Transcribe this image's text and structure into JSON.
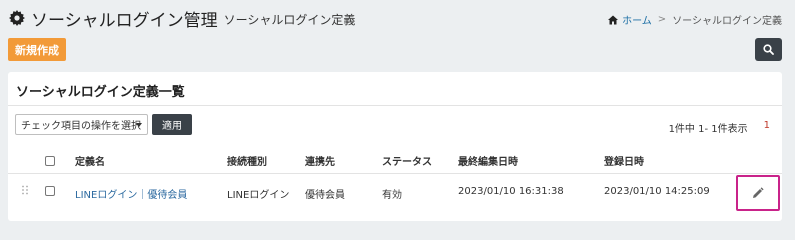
{
  "header": {
    "title": "ソーシャルログイン管理",
    "subtitle": "ソーシャルログイン定義",
    "icon": "gear-icon"
  },
  "breadcrumb": {
    "home_icon": "home-icon",
    "home_label": "ホーム",
    "separator": ">",
    "current": "ソーシャルログイン定義"
  },
  "toolbar": {
    "new_label": "新規作成",
    "search_icon": "search-icon"
  },
  "panel": {
    "title": "ソーシャルログイン定義一覧",
    "bulk_action_placeholder": "チェック項目の操作を選択",
    "apply_label": "適用",
    "pagination_summary": "1件中 1- 1件表示",
    "current_page": "1"
  },
  "table": {
    "columns": [
      "定義名",
      "接続種別",
      "連携先",
      "ステータス",
      "最終編集日時",
      "登録日時"
    ],
    "rows": [
      {
        "name": "LINEログイン｜優待会員",
        "type": "LINEログイン",
        "partner": "優待会員",
        "status": "有効",
        "updated": "2023/01/10 16:31:38",
        "created": "2023/01/10 14:25:09"
      }
    ]
  },
  "colors": {
    "accent_orange": "#f29a38",
    "dark_button": "#3a4148",
    "link": "#2c6aa0",
    "highlight": "#c9238a"
  }
}
